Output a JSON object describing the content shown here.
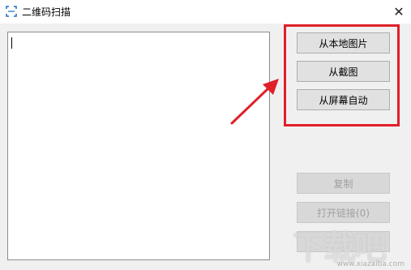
{
  "window": {
    "title": "二维码扫描",
    "close_glyph": "✕",
    "app_icon": "scan-frame-icon"
  },
  "buttons": {
    "from_local_image": "从本地图片",
    "from_screenshot": "从截图",
    "from_screen_auto": "从屏幕自动",
    "copy": "复制",
    "open_link": "打开链接(0)"
  },
  "result_area": {
    "value": ""
  },
  "annotation": {
    "highlight_color": "#e0202a",
    "arrow_color": "#e0202a"
  },
  "watermark": {
    "brand": "下载吧",
    "url": "www.xiazaiba.com"
  }
}
